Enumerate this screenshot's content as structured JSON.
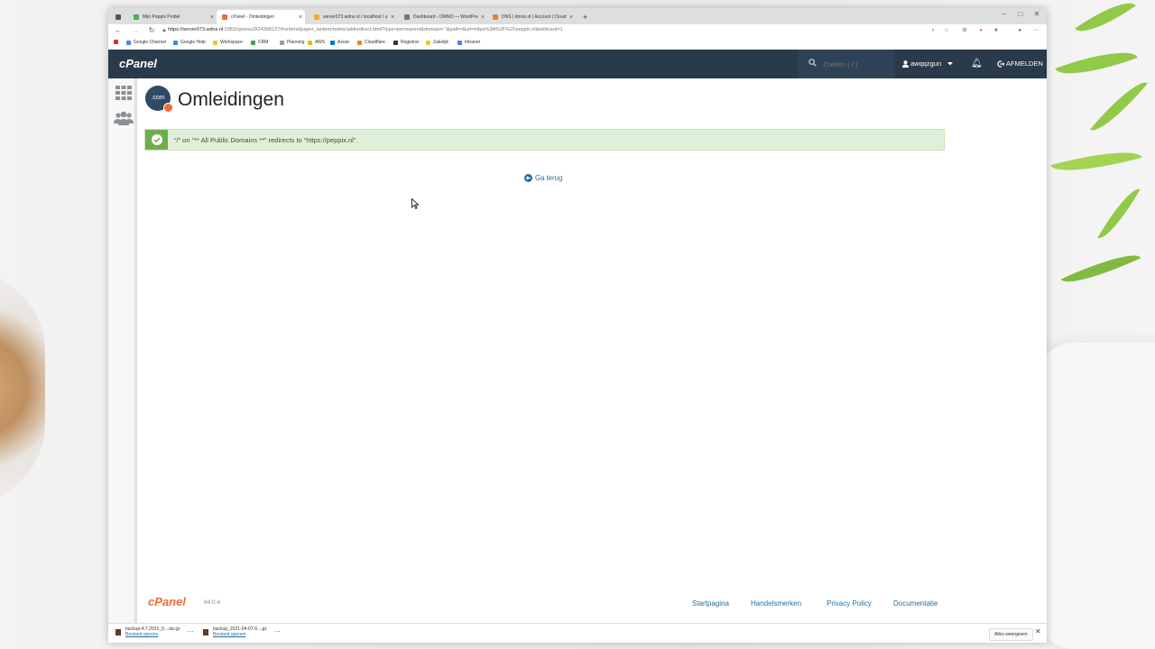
{
  "browser": {
    "tabs": [
      {
        "title": "Mijn Peppix Profiel",
        "color": "#4caf50",
        "active": false
      },
      {
        "title": "cPanel - Omleidingen",
        "color": "#ee6b3b",
        "active": true
      },
      {
        "title": "server073.wdns.nl / localhost / u",
        "color": "#f2a93b",
        "active": false
      },
      {
        "title": "Dashboard ‹ OMNO — WordPre",
        "color": "#777777",
        "active": false
      },
      {
        "title": "DNS | dmno.nl | Account | Cloud",
        "color": "#f38020",
        "active": false
      }
    ],
    "url_host": "https://server073.wdns.nl",
    "url_path": ":2083/cpsess2824368137/frontend/paper_lantern/mime/addredirect.html?type=permanent&domain=.*&path=&url=https%3A%2F%2Fpeppix.nl&wildcard=1",
    "bookmarks": [
      {
        "label": "",
        "color": "#d93025"
      },
      {
        "label": "Google Channel",
        "color": "#4285f4"
      },
      {
        "label": "Google Help",
        "color": "#4285f4"
      },
      {
        "label": "Workspace",
        "color": "#f4c430"
      },
      {
        "label": "CRM",
        "color": "#34a853"
      },
      {
        "label": "Planning",
        "color": "#9e9e9e"
      },
      {
        "label": "AWS",
        "color": "#f4b400"
      },
      {
        "label": "Azure",
        "color": "#0078d4"
      },
      {
        "label": "Cloudflare",
        "color": "#f38020"
      },
      {
        "label": "Registrar",
        "color": "#333333"
      },
      {
        "label": "Zakelijk",
        "color": "#f4c430"
      },
      {
        "label": "Intranet",
        "color": "#4285f4"
      }
    ]
  },
  "cpanel": {
    "logo": "cPanel",
    "search_placeholder": "Zoeken ( / )",
    "username": "awqqzgun",
    "logout_label": "AFMELDEN",
    "page_title": "Omleidingen",
    "page_icon_text": ".com",
    "alert_text": "“/” on “** All Public Domains **” redirects to “https://peppix.nl”.",
    "go_back_label": "Ga terug",
    "footer": {
      "logo": "cPanel",
      "version": "94.0.4",
      "links": [
        "Startpagina",
        "Handelsmerken",
        "Privacy Policy",
        "Documentatie"
      ]
    }
  },
  "downloads": {
    "items": [
      {
        "name": "backup-4.7.2021_0....tar.gz",
        "action": "Bestand openen"
      },
      {
        "name": "backup_2021-04-07-0....gz",
        "action": "Bestand openen"
      }
    ],
    "show_all": "Alles weergeven"
  },
  "colors": {
    "header_bg": "#293a4a",
    "accent_orange": "#ee6b3b",
    "success_bg": "#dff0d8",
    "success_icon": "#6fad4f",
    "link": "#1f6ea8"
  }
}
